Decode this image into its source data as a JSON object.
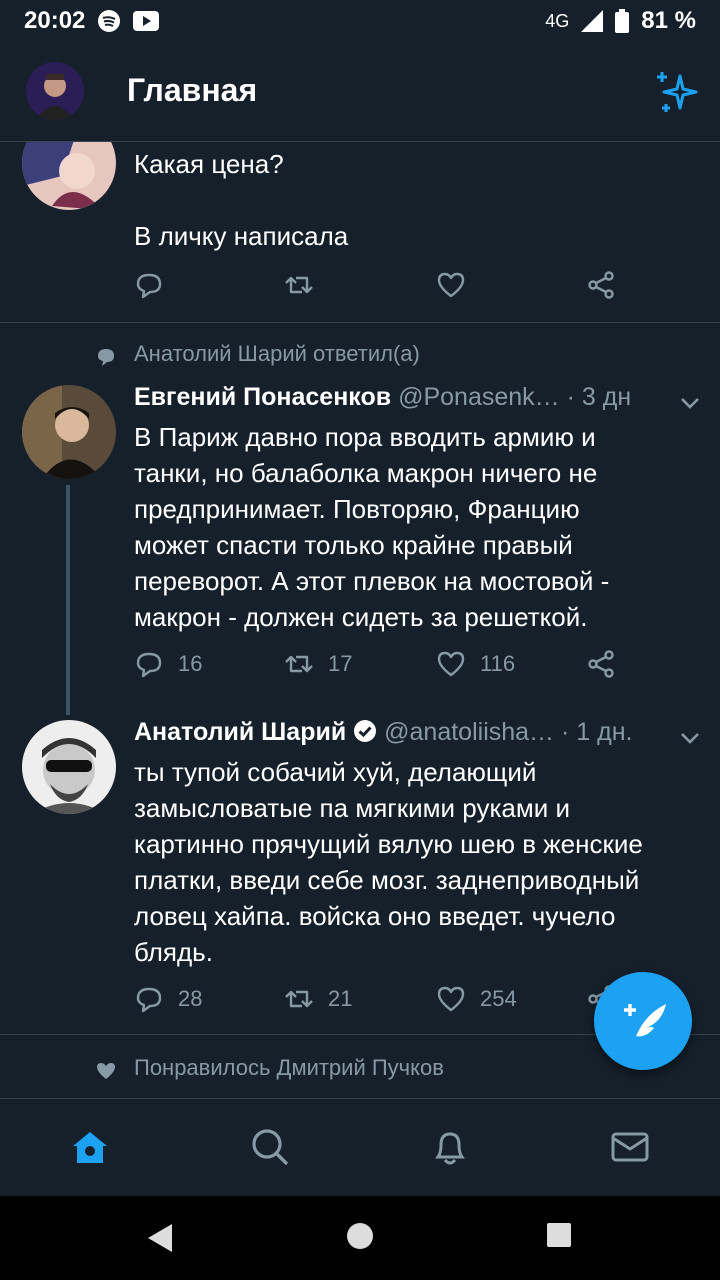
{
  "status_bar": {
    "time": "20:02",
    "network": "4G",
    "battery": "81 %"
  },
  "header": {
    "title": "Главная"
  },
  "tweets": [
    {
      "lines": [
        "Какая цена?",
        "",
        "В личку написала"
      ],
      "stats": {
        "replies": "",
        "retweets": "",
        "likes": ""
      }
    },
    {
      "social_context": "Анатолий Шарий ответил(а)",
      "name": "Евгений Понасенков",
      "handle": "@Ponasenk…",
      "time": "· 3 дн",
      "lines": [
        "В Париж давно пора вводить армию и",
        "танки, но балаболка макрон ничего не",
        "предпринимает. Повторяю, Францию",
        "может спасти только крайне правый",
        "переворот. А этот плевок на мостовой -",
        "макрон - должен сидеть за решеткой."
      ],
      "stats": {
        "replies": "16",
        "retweets": "17",
        "likes": "116"
      }
    },
    {
      "name": "Анатолий Шарий",
      "handle": "@anatoliisha…",
      "time": "· 1 дн.",
      "lines": [
        "ты тупой собачий хуй, делающий",
        "замысловатые па мягкими руками и",
        "картинно прячущий вялую шею в женские",
        "платки, введи себе мозг. заднеприводный",
        "ловец хайпа. войска оно введет. чучело",
        "блядь."
      ],
      "stats": {
        "replies": "28",
        "retweets": "21",
        "likes": "254"
      }
    },
    {
      "social_context": "Понравилось Дмитрий Пучков"
    }
  ],
  "colors": {
    "background": "#15202b",
    "accent": "#1da1f2",
    "muted": "#8899a6",
    "divider": "#38444d"
  },
  "icons": [
    "spotify-icon",
    "youtube-icon",
    "signal-icon",
    "battery-icon",
    "sparkle-icon",
    "reply-icon",
    "retweet-icon",
    "like-icon",
    "share-icon",
    "verified-icon",
    "compose-icon",
    "home-icon",
    "search-icon",
    "bell-icon",
    "mail-icon"
  ]
}
